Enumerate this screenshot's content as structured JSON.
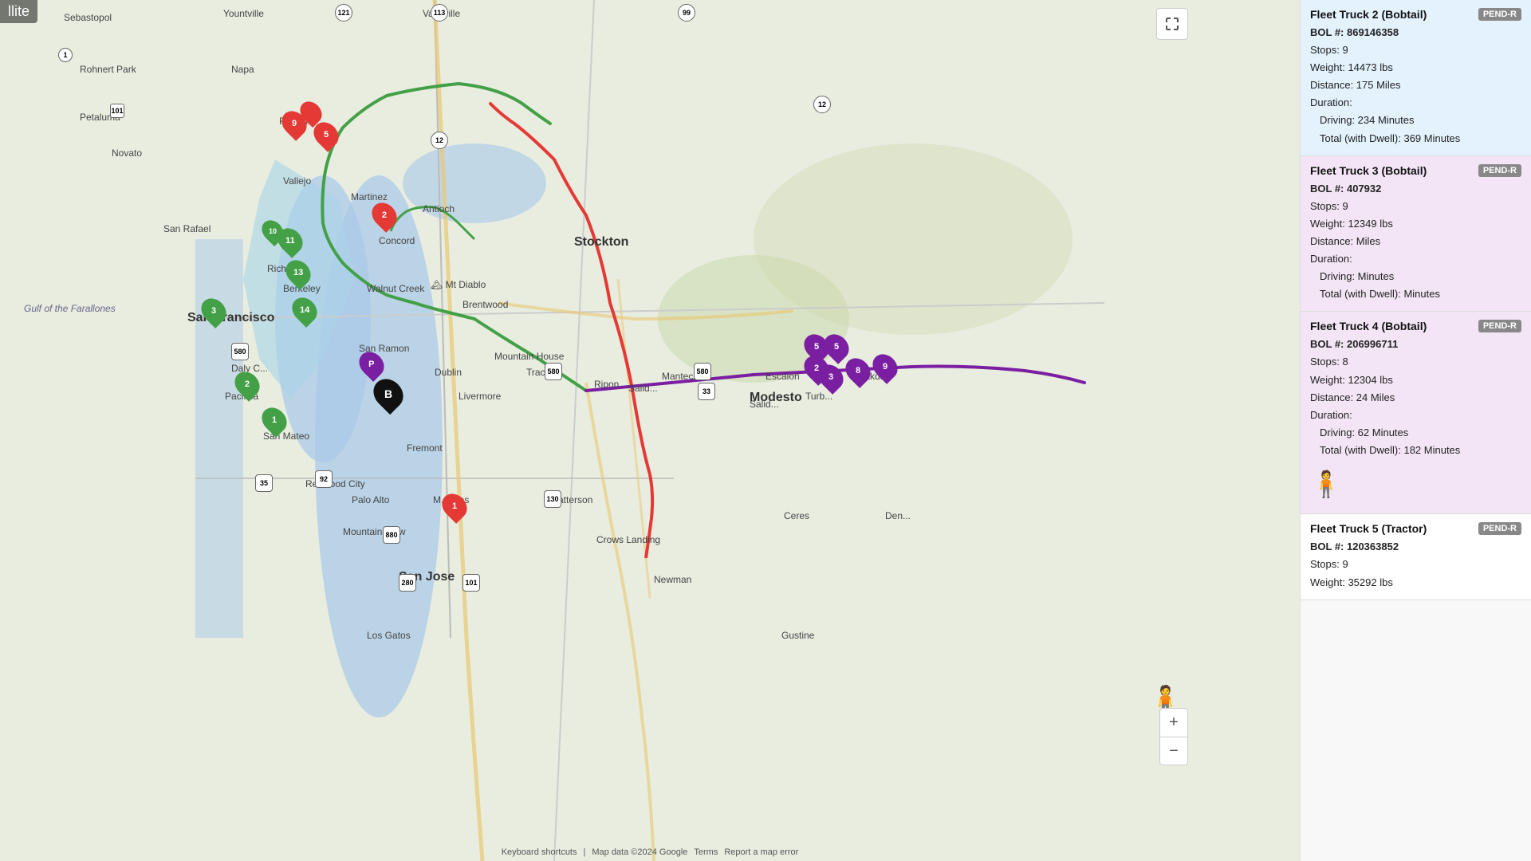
{
  "map": {
    "satellite_label": "llite",
    "attribution": {
      "keyboard": "Keyboard shortcuts",
      "map_data": "Map data ©2024 Google",
      "terms": "Terms",
      "report": "Report a map error"
    }
  },
  "trucks": [
    {
      "name": "Fleet Truck 2 (Bobtail)",
      "badge": "PEND-R",
      "bol": "BOL #: 869146358",
      "stops": "Stops: 9",
      "weight": "Weight: 14473 lbs",
      "distance": "Distance: 175 Miles",
      "duration_label": "Duration:",
      "driving": "Driving: 234 Minutes",
      "total": "Total (with Dwell): 369 Minutes",
      "bg": "blue-bg",
      "has_person": false
    },
    {
      "name": "Fleet Truck 3 (Bobtail)",
      "badge": "PEND-R",
      "bol": "BOL #: 407932",
      "stops": "Stops: 9",
      "weight": "Weight: 12349 lbs",
      "distance": "Distance: Miles",
      "duration_label": "Duration:",
      "driving": "Driving: Minutes",
      "total": "Total (with Dwell): Minutes",
      "bg": "purple-bg",
      "has_person": false
    },
    {
      "name": "Fleet Truck 4 (Bobtail)",
      "badge": "PEND-R",
      "bol": "BOL #: 206996711",
      "stops": "Stops: 8",
      "weight": "Weight: 12304 lbs",
      "distance": "Distance: 24 Miles",
      "duration_label": "Duration:",
      "driving": "Driving: 62 Minutes",
      "total": "Total (with Dwell): 182 Minutes",
      "bg": "purple2-bg",
      "has_person": true
    },
    {
      "name": "Fleet Truck 5 (Tractor)",
      "badge": "PEND-R",
      "bol": "BOL #: 120363852",
      "stops": "Stops: 9",
      "weight": "Weight: 35292 lbs",
      "distance": "",
      "duration_label": "",
      "driving": "",
      "total": "",
      "bg": "white-bg",
      "has_person": false
    }
  ],
  "zoom_plus": "+",
  "zoom_minus": "−",
  "fullscreen_icon": "⛶"
}
